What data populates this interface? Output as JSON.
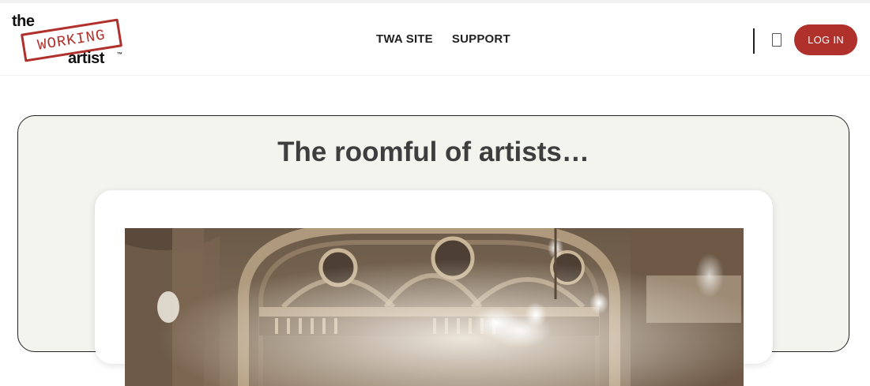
{
  "logo": {
    "word_top": "the",
    "stamp_text": "WORKING",
    "word_bottom": "artist",
    "trademark": "™"
  },
  "nav": {
    "items": [
      {
        "label": "TWA SITE"
      },
      {
        "label": "SUPPORT"
      }
    ]
  },
  "header": {
    "login_label": "LOG IN"
  },
  "main": {
    "title": "The roomful of artists…"
  },
  "colors": {
    "brand_red": "#b0302b",
    "card_bg": "#f4f4ef",
    "title_text": "#3e3e3e"
  },
  "icons": {
    "cart": "cart-icon"
  }
}
